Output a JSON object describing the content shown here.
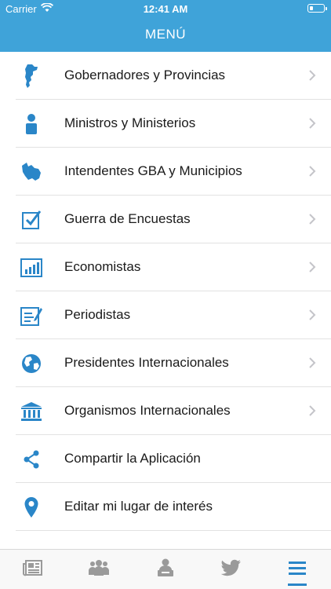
{
  "status_bar": {
    "carrier": "Carrier",
    "time": "12:41 AM"
  },
  "nav": {
    "title": "MENÚ"
  },
  "menu": {
    "items": [
      {
        "label": "Gobernadores y Provincias",
        "icon": "argentina-map-icon",
        "chevron": true
      },
      {
        "label": "Ministros y Ministerios",
        "icon": "person-icon",
        "chevron": true
      },
      {
        "label": "Intendentes GBA y Municipios",
        "icon": "province-map-icon",
        "chevron": true
      },
      {
        "label": "Guerra de Encuestas",
        "icon": "checkbox-icon",
        "chevron": true
      },
      {
        "label": "Economistas",
        "icon": "bar-chart-icon",
        "chevron": true
      },
      {
        "label": "Periodistas",
        "icon": "edit-document-icon",
        "chevron": true
      },
      {
        "label": "Presidentes Internacionales",
        "icon": "globe-icon",
        "chevron": true
      },
      {
        "label": "Organismos Internacionales",
        "icon": "institution-icon",
        "chevron": true
      },
      {
        "label": "Compartir la Aplicación",
        "icon": "share-icon",
        "chevron": false
      },
      {
        "label": "Editar mi lugar de interés",
        "icon": "location-pin-icon",
        "chevron": false
      }
    ]
  },
  "tabs": [
    {
      "icon": "newspaper-icon",
      "active": false
    },
    {
      "icon": "group-icon",
      "active": false
    },
    {
      "icon": "speaker-icon",
      "active": false
    },
    {
      "icon": "twitter-icon",
      "active": false
    },
    {
      "icon": "menu-icon",
      "active": true
    }
  ],
  "colors": {
    "accent": "#3fa3d9",
    "icon": "#2a86c8",
    "tab_inactive": "#9a9a9a"
  }
}
